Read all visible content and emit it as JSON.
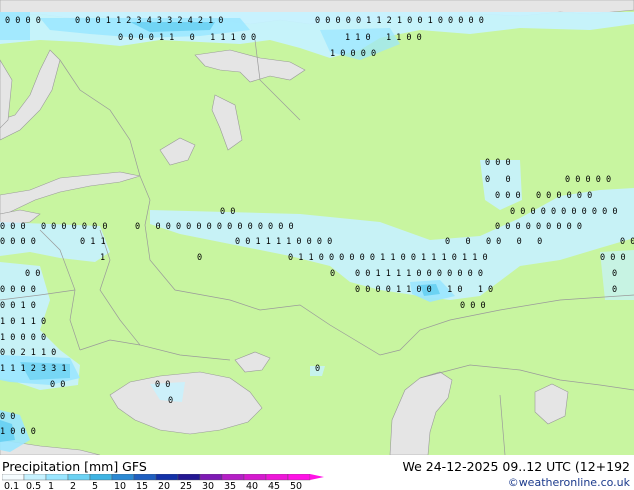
{
  "footer": {
    "title": "Precipitation [mm]  GFS",
    "valid_time": "We 24-12-2025 09..12 UTC (12+192",
    "credit": "©weatheronline.co.uk"
  },
  "colorbar": {
    "labels": [
      "0.1",
      "0.5",
      "1",
      "2",
      "5",
      "10",
      "15",
      "20",
      "25",
      "30",
      "35",
      "40",
      "45",
      "50"
    ],
    "colors": [
      "#f5fcff",
      "#c6f2ff",
      "#9ae6ff",
      "#6cd2f3",
      "#3fb4e3",
      "#2b89d3",
      "#1f5fc0",
      "#1332a8",
      "#241893",
      "#7e1ab4",
      "#b51fc6",
      "#d51acf",
      "#ee17d9",
      "#ff12e6"
    ]
  },
  "map": {
    "land_color": "#c8f5a0",
    "sea_color": "#e5e5e5",
    "border_color": "#9a9a9a",
    "value_labels": [
      {
        "t": "0 0 0 1 1 2 3 4 3 3 2 4 2 1 0",
        "pos": [
          75,
          23
        ]
      },
      {
        "t": "0 0 0 0 0 1 1 2 1 0 0 1 0 0 0 0 0",
        "pos": [
          315,
          23
        ]
      },
      {
        "t": "0 0 0 0 1 1   0   1 1 1 0 0",
        "pos": [
          118,
          40
        ]
      },
      {
        "t": "1 1 0   1 1 0 0",
        "pos": [
          345,
          40
        ]
      },
      {
        "t": "1 0 0 0 0",
        "pos": [
          330,
          56
        ]
      },
      {
        "t": "0 0 0 0",
        "pos": [
          5,
          23
        ]
      },
      {
        "t": "0 0 0",
        "pos": [
          485,
          165
        ]
      },
      {
        "t": "0   0",
        "pos": [
          485,
          182
        ]
      },
      {
        "t": "0 0 0 0 0",
        "pos": [
          565,
          182
        ]
      },
      {
        "t": "0 0 0   0 0 0 0 0 0",
        "pos": [
          495,
          198
        ]
      },
      {
        "t": "0 0",
        "pos": [
          220,
          214
        ]
      },
      {
        "t": "0 0 0 0 0 0 0 0 0 0 0",
        "pos": [
          510,
          214
        ]
      },
      {
        "t": "0 0 0   0 0 0 0 0 0 0",
        "pos": [
          0,
          229
        ]
      },
      {
        "t": "0   0 0 0 0 0 0 0 0 0 0 0 0 0 0",
        "pos": [
          135,
          229
        ]
      },
      {
        "t": "0 0 0 0 0 0 0 0 0",
        "pos": [
          495,
          229
        ]
      },
      {
        "t": "0 0 0 0",
        "pos": [
          0,
          244
        ]
      },
      {
        "t": "0 1 1",
        "pos": [
          80,
          244
        ]
      },
      {
        "t": "0 0 1 1 1 1 0 0 0 0",
        "pos": [
          235,
          244
        ]
      },
      {
        "t": "0   0   0 0   0   0",
        "pos": [
          445,
          244
        ]
      },
      {
        "t": "0 0",
        "pos": [
          620,
          244
        ]
      },
      {
        "t": "1",
        "pos": [
          100,
          260
        ]
      },
      {
        "t": "0",
        "pos": [
          197,
          260
        ]
      },
      {
        "t": "0 1 1 0 0 0 0 0 0 1 1 0 0 1 1 1 0 1 1 0",
        "pos": [
          288,
          260
        ]
      },
      {
        "t": "0 0 0",
        "pos": [
          600,
          260
        ]
      },
      {
        "t": "0 0",
        "pos": [
          25,
          276
        ]
      },
      {
        "t": "0",
        "pos": [
          330,
          276
        ]
      },
      {
        "t": "0 0 1 1 1 1 0 0 0 0 0 0 0",
        "pos": [
          355,
          276
        ]
      },
      {
        "t": "0",
        "pos": [
          612,
          276
        ]
      },
      {
        "t": "0 0 0 0 1 1 0 0   1 0   1 0",
        "pos": [
          355,
          292
        ]
      },
      {
        "t": "0 0 0 0",
        "pos": [
          0,
          292
        ]
      },
      {
        "t": "0",
        "pos": [
          612,
          292
        ]
      },
      {
        "t": "0 0 1 0",
        "pos": [
          0,
          308
        ]
      },
      {
        "t": "0 0 0",
        "pos": [
          460,
          308
        ]
      },
      {
        "t": "1 0 1 1 0",
        "pos": [
          0,
          324
        ]
      },
      {
        "t": "1 0 0 0 0",
        "pos": [
          0,
          340
        ]
      },
      {
        "t": "0 0 2 1 1 0",
        "pos": [
          0,
          355
        ]
      },
      {
        "t": "1 1 1 2 3 3 1",
        "pos": [
          0,
          371
        ]
      },
      {
        "t": "0",
        "pos": [
          315,
          371
        ]
      },
      {
        "t": "0 0",
        "pos": [
          50,
          387
        ]
      },
      {
        "t": "0 0",
        "pos": [
          155,
          387
        ]
      },
      {
        "t": "0",
        "pos": [
          168,
          403
        ]
      },
      {
        "t": "0 0",
        "pos": [
          0,
          419
        ]
      },
      {
        "t": "1 0 0 0",
        "pos": [
          0,
          434
        ]
      }
    ]
  }
}
